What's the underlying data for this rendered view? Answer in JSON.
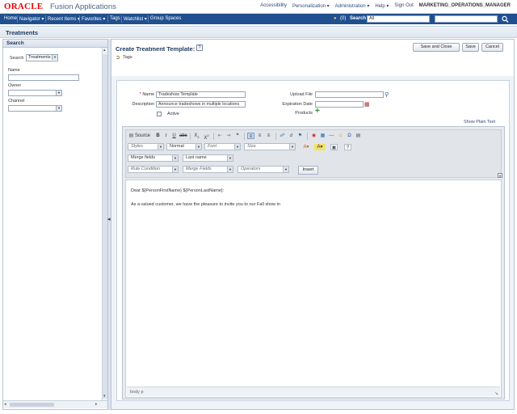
{
  "app": {
    "brand": "ORACLE",
    "product": "Fusion Applications",
    "brand_color": "#e00000",
    "nav_color": "#20508f"
  },
  "top_links": {
    "accessibility": "Accessibility",
    "personalization": "Personalization ▾",
    "administration": "Administration ▾",
    "help": "Help ▾",
    "sign_out": "Sign Out",
    "user": "MARKETING_OPERATIONS_MANAGER"
  },
  "nav": {
    "home": "Home",
    "navigator": "Navigator ▾",
    "recent_items": "Recent Items ▾",
    "favorites": "Favorites ▾",
    "tags": "Tags",
    "watchlist": "Watchlist ▾",
    "group_spaces": "Group Spaces",
    "notifications_count": "(0)",
    "search_label": "Search",
    "search_scope": "All"
  },
  "page_title_bar": "Treatments",
  "left_panel": {
    "header": "Search",
    "search_label": "Search",
    "search_value": "Treatments",
    "name_label": "Name",
    "owner_label": "Owner",
    "channel_label": "Channel"
  },
  "main": {
    "title": "Create Treatment Template:",
    "help_icon_text": "?",
    "tags_label": "Tags",
    "buttons": {
      "save_and_close": "Save and Close",
      "save": "Save",
      "cancel": "Cancel"
    },
    "form": {
      "name_label": "Name",
      "name_value": "Tradeshow Template",
      "description_label": "Description",
      "description_value": "Announce tradeshows in multiple locations",
      "active_label": "Active",
      "upload_label": "Upload File",
      "expiration_label": "Expiration Date",
      "products_label": "Products"
    },
    "show_plain_text": "Show Plain Text",
    "editor": {
      "source_label": "Source",
      "styles": "Styles",
      "format": "Normal",
      "font": "Font",
      "size": "Size",
      "merge_fields_select": "Merge fields",
      "merge_field_value": "Last name",
      "rule_condition": "Rule Condition",
      "merge_fields": "Merge Fields",
      "operators": "Operators",
      "insert": "Insert",
      "line1": "Dear ${PersonFirstName} ${PersonLastName}:",
      "line2": "As a valued customer, we have the pleasure to invite you to our Fall show in",
      "status_path": "body  p"
    }
  }
}
